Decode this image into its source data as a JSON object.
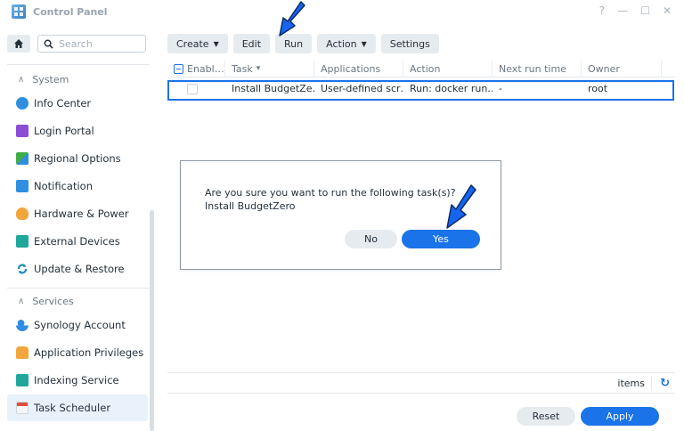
{
  "window": {
    "title": "Control Panel",
    "controls": [
      "?",
      "—",
      "☐",
      "✕"
    ]
  },
  "sidebar": {
    "search_placeholder": "Search",
    "groups": [
      {
        "label": "System",
        "items": [
          {
            "label": "Info Center",
            "icon": "info-icon",
            "color": "#2f8ee0"
          },
          {
            "label": "Login Portal",
            "icon": "login-portal-icon",
            "color": "#8a4fd6"
          },
          {
            "label": "Regional Options",
            "icon": "regional-options-icon",
            "color": "#3fae49"
          },
          {
            "label": "Notification",
            "icon": "notification-icon",
            "color": "#2f8ee0"
          },
          {
            "label": "Hardware & Power",
            "icon": "hardware-power-icon",
            "color": "#f2a53b"
          },
          {
            "label": "External Devices",
            "icon": "external-devices-icon",
            "color": "#1fa89a"
          },
          {
            "label": "Update & Restore",
            "icon": "update-restore-icon",
            "color": "#1f8fb5"
          }
        ]
      },
      {
        "label": "Services",
        "items": [
          {
            "label": "Synology Account",
            "icon": "synology-account-icon",
            "color": "#2f8ee0"
          },
          {
            "label": "Application Privileges",
            "icon": "application-privileges-icon",
            "color": "#f2a53b"
          },
          {
            "label": "Indexing Service",
            "icon": "indexing-service-icon",
            "color": "#1fa89a"
          },
          {
            "label": "Task Scheduler",
            "icon": "task-scheduler-icon",
            "color": "#e04c3c"
          }
        ]
      }
    ],
    "active_item": "Task Scheduler"
  },
  "toolbar": {
    "create": "Create",
    "edit": "Edit",
    "run": "Run",
    "action": "Action",
    "settings": "Settings"
  },
  "table": {
    "columns": [
      "Enabl…",
      "Task",
      "Applications",
      "Action",
      "Next run time",
      "Owner"
    ],
    "sort_indicator": "▾",
    "rows": [
      {
        "enabled": false,
        "task": "Install BudgetZe…",
        "application": "User-defined scr…",
        "action": "Run: docker run…",
        "next_run": "-",
        "owner": "root"
      }
    ]
  },
  "footer": {
    "items_label": "items",
    "reset": "Reset",
    "apply": "Apply"
  },
  "dialog": {
    "message": "Are you sure you want to run the following task(s)?",
    "task": "Install BudgetZero",
    "no": "No",
    "yes": "Yes"
  },
  "colors": {
    "accent": "#1a73e8",
    "annotation_arrow": "#1565f0"
  }
}
